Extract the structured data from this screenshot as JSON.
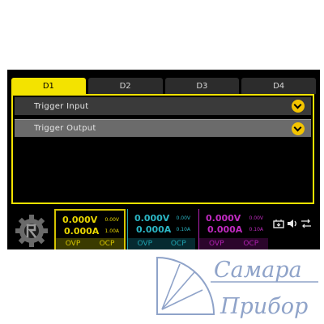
{
  "tabs": [
    {
      "label": "D1",
      "active": true
    },
    {
      "label": "D2",
      "active": false
    },
    {
      "label": "D3",
      "active": false
    },
    {
      "label": "D4",
      "active": false
    }
  ],
  "rows": [
    {
      "label": "Trigger Input"
    },
    {
      "label": "Trigger Output"
    }
  ],
  "channels": [
    {
      "voltage": "0.000V",
      "current": "0.000A",
      "set_voltage": "0.00V",
      "set_current": "1.00A",
      "ovp": "OVP",
      "ocp": "OCP",
      "color": "#e8d600"
    },
    {
      "voltage": "0.000V",
      "current": "0.000A",
      "set_voltage": "0.00V",
      "set_current": "0.10A",
      "ovp": "OVP",
      "ocp": "OCP",
      "color": "#2bb5c4"
    },
    {
      "voltage": "0.000V",
      "current": "0.000A",
      "set_voltage": "0.00V",
      "set_current": "0.10A",
      "ovp": "OVP",
      "ocp": "OCP",
      "color": "#c02ac0"
    }
  ],
  "status_icons": [
    "usb-device-icon",
    "speaker-icon",
    "transfer-icon"
  ],
  "watermark": {
    "line1": "Самара",
    "line2": "Прибор"
  },
  "colors": {
    "accent": "#f3e300",
    "chevron": "#f3c400"
  }
}
